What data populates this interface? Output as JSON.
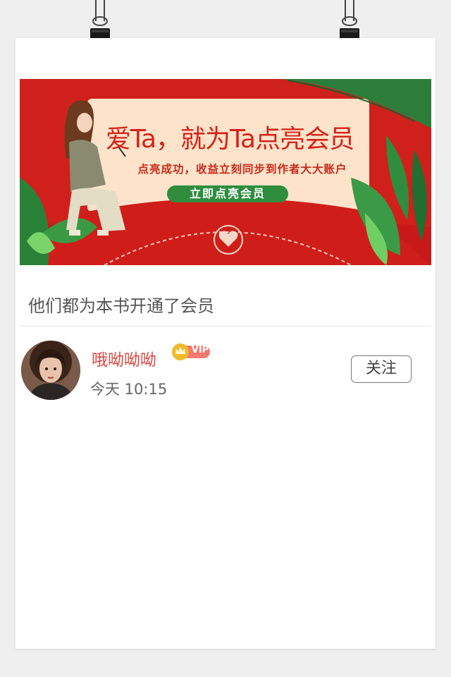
{
  "banner": {
    "title": "爱Ta，就为Ta点亮会员",
    "subtitle": "点亮成功，收益立刻同步到作者大大账户",
    "cta_label": "立即点亮会员"
  },
  "section": {
    "title": "他们都为本书开通了会员"
  },
  "members": [
    {
      "name": "哦呦呦呦",
      "badge": "VIP",
      "time": "今天 10:15",
      "follow_label": "关注"
    }
  ],
  "colors": {
    "banner_red": "#d0201b",
    "banner_cream": "#fde3c9",
    "cta_green": "#2f8d3d",
    "username_red": "#d9473f",
    "vip_gold": "#f0b92a"
  },
  "icons": {
    "binder_clip": "binder-clip-icon",
    "heart_stamp": "heart-icon",
    "crown": "crown-icon"
  }
}
